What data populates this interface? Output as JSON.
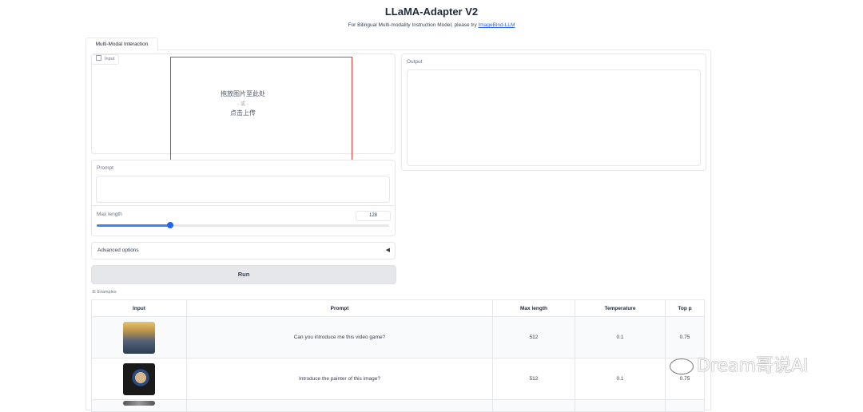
{
  "header": {
    "title": "LLaMA-Adapter V2",
    "subtitle_text": "For Bilingual Multi-modality Instruction Model, please try",
    "subtitle_link": "ImageBind-LLM"
  },
  "tabs": [
    {
      "label": "Multi-Modal Interaction"
    }
  ],
  "input": {
    "chip_label": "Input",
    "drop_line1": "拖放图片至此处",
    "drop_or": "- 或 -",
    "drop_line2": "点击上传"
  },
  "output": {
    "label": "Output"
  },
  "prompt": {
    "label": "Prompt",
    "value": ""
  },
  "max_length": {
    "label": "Max length",
    "value": "128",
    "slider_fraction": 0.25
  },
  "advanced": {
    "label": "Advanced options",
    "caret": "◀"
  },
  "run": {
    "label": "Run"
  },
  "examples": {
    "label": "☰ Examples",
    "columns": [
      "Input",
      "Prompt",
      "Max length",
      "Temperature",
      "Top p"
    ],
    "rows": [
      {
        "prompt": "Can you introduce me this video game?",
        "max_length": "512",
        "temperature": "0.1",
        "top_p": "0.75"
      },
      {
        "prompt": "Introduce the painter of this image?",
        "max_length": "512",
        "temperature": "0.1",
        "top_p": "0.75"
      }
    ]
  },
  "watermark": "Dream哥说AI",
  "colors": {
    "accent": "#2563eb",
    "highlight_box": "#e53935",
    "run_button": "#e5e7eb"
  }
}
